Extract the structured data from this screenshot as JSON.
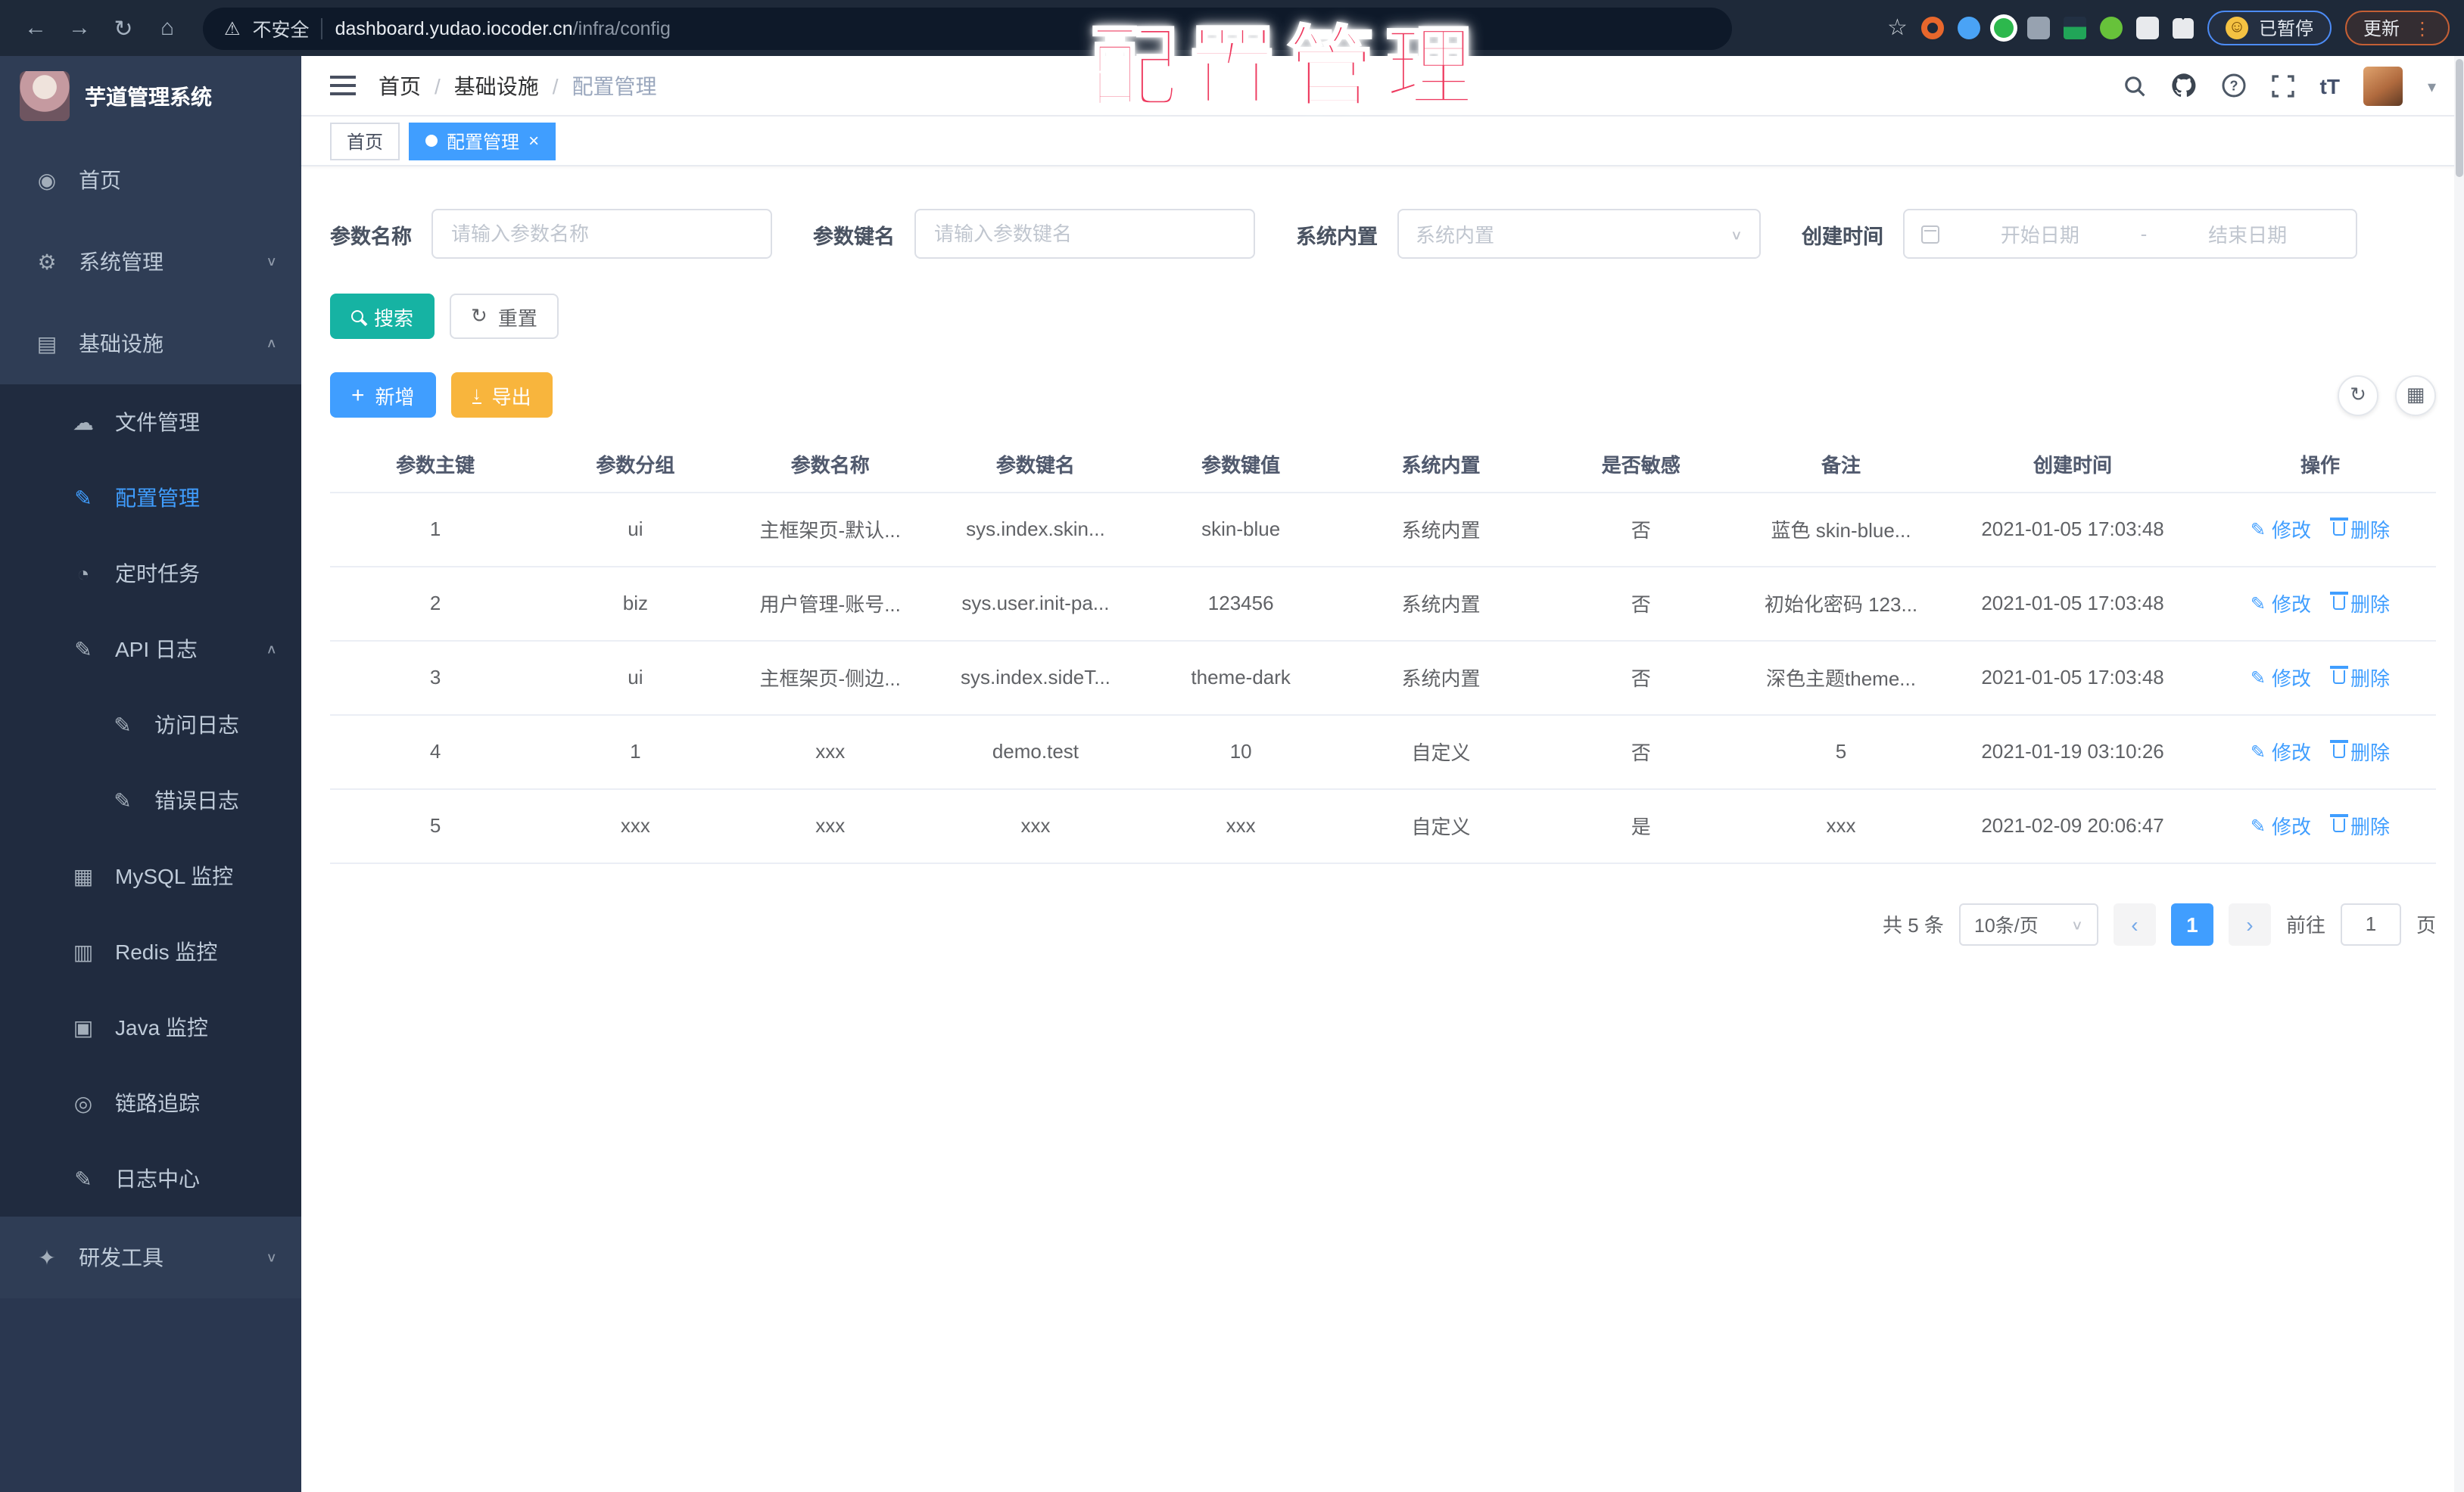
{
  "browser": {
    "security_label": "不安全",
    "url_host": "dashboard.yudao.iocoder.cn",
    "url_path": "/infra/config",
    "paused_label": "已暂停",
    "update_label": "更新",
    "extension_colors": [
      "#e8672c",
      "#4aa3f5",
      "#2db84d",
      "#97a2b0",
      "#223043",
      "#67c23a",
      "#e8eaed"
    ]
  },
  "watermark": {
    "text": "配置管理",
    "color": "#ee3a5f"
  },
  "sidebar": {
    "title": "芋道管理系统",
    "items": [
      {
        "label": "首页",
        "icon": "dashboard-icon",
        "level": 1
      },
      {
        "label": "系统管理",
        "icon": "gear-icon",
        "level": 1,
        "chevron": "down"
      },
      {
        "label": "基础设施",
        "icon": "infrastructure-icon",
        "level": 1,
        "chevron": "up"
      },
      {
        "label": "文件管理",
        "icon": "file-manage-icon",
        "level": 2
      },
      {
        "label": "配置管理",
        "icon": "config-manage-icon",
        "level": 2,
        "active": true
      },
      {
        "label": "定时任务",
        "icon": "timer-task-icon",
        "level": 2
      },
      {
        "label": "API 日志",
        "icon": "api-log-icon",
        "level": 2,
        "chevron": "up"
      },
      {
        "label": "访问日志",
        "icon": "access-log-icon",
        "level": 3
      },
      {
        "label": "错误日志",
        "icon": "error-log-icon",
        "level": 3
      },
      {
        "label": "MySQL 监控",
        "icon": "mysql-monitor-icon",
        "level": 2
      },
      {
        "label": "Redis 监控",
        "icon": "redis-monitor-icon",
        "level": 2
      },
      {
        "label": "Java 监控",
        "icon": "java-monitor-icon",
        "level": 2
      },
      {
        "label": "链路追踪",
        "icon": "trace-icon",
        "level": 2
      },
      {
        "label": "日志中心",
        "icon": "log-center-icon",
        "level": 2
      },
      {
        "label": "研发工具",
        "icon": "dev-tools-icon",
        "level": 1,
        "chevron": "down"
      }
    ]
  },
  "header": {
    "breadcrumb": [
      "首页",
      "基础设施",
      "配置管理"
    ],
    "breadcrumb_separator": "/",
    "font_icon_label": "tT"
  },
  "tabs": [
    {
      "label": "首页",
      "active": false
    },
    {
      "label": "配置管理",
      "active": true
    }
  ],
  "filters": {
    "name_label": "参数名称",
    "name_placeholder": "请输入参数名称",
    "key_label": "参数键名",
    "key_placeholder": "请输入参数键名",
    "builtin_label": "系统内置",
    "builtin_placeholder": "系统内置",
    "date_label": "创建时间",
    "date_start_placeholder": "开始日期",
    "date_separator": "-",
    "date_end_placeholder": "结束日期",
    "search_label": "搜索",
    "reset_label": "重置"
  },
  "toolbar": {
    "add_label": "新增",
    "export_label": "导出"
  },
  "table": {
    "headers": [
      "参数主键",
      "参数分组",
      "参数名称",
      "参数键名",
      "参数键值",
      "系统内置",
      "是否敏感",
      "备注",
      "创建时间",
      "操作"
    ],
    "edit_label": "修改",
    "delete_label": "删除",
    "rows": [
      {
        "cells": [
          "1",
          "ui",
          "主框架页-默认...",
          "sys.index.skin...",
          "skin-blue",
          "系统内置",
          "否",
          "蓝色 skin-blue...",
          "2021-01-05 17:03:48"
        ]
      },
      {
        "cells": [
          "2",
          "biz",
          "用户管理-账号...",
          "sys.user.init-pa...",
          "123456",
          "系统内置",
          "否",
          "初始化密码 123...",
          "2021-01-05 17:03:48"
        ]
      },
      {
        "cells": [
          "3",
          "ui",
          "主框架页-侧边...",
          "sys.index.sideT...",
          "theme-dark",
          "系统内置",
          "否",
          "深色主题theme...",
          "2021-01-05 17:03:48"
        ]
      },
      {
        "cells": [
          "4",
          "1",
          "xxx",
          "demo.test",
          "10",
          "自定义",
          "否",
          "5",
          "2021-01-19 03:10:26"
        ]
      },
      {
        "cells": [
          "5",
          "xxx",
          "xxx",
          "xxx",
          "xxx",
          "自定义",
          "是",
          "xxx",
          "2021-02-09 20:06:47"
        ]
      }
    ]
  },
  "pagination": {
    "total_label": "共 5 条",
    "page_size_label": "10条/页",
    "prev": "‹",
    "current_page": "1",
    "next": "›",
    "goto_label": "前往",
    "goto_value": "1",
    "page_unit": "页"
  },
  "colors": {
    "accent": "#409eff",
    "search_button": "#16b3a3",
    "export_button": "#f8b53d",
    "sidebar_bg": "#2f3d55"
  }
}
